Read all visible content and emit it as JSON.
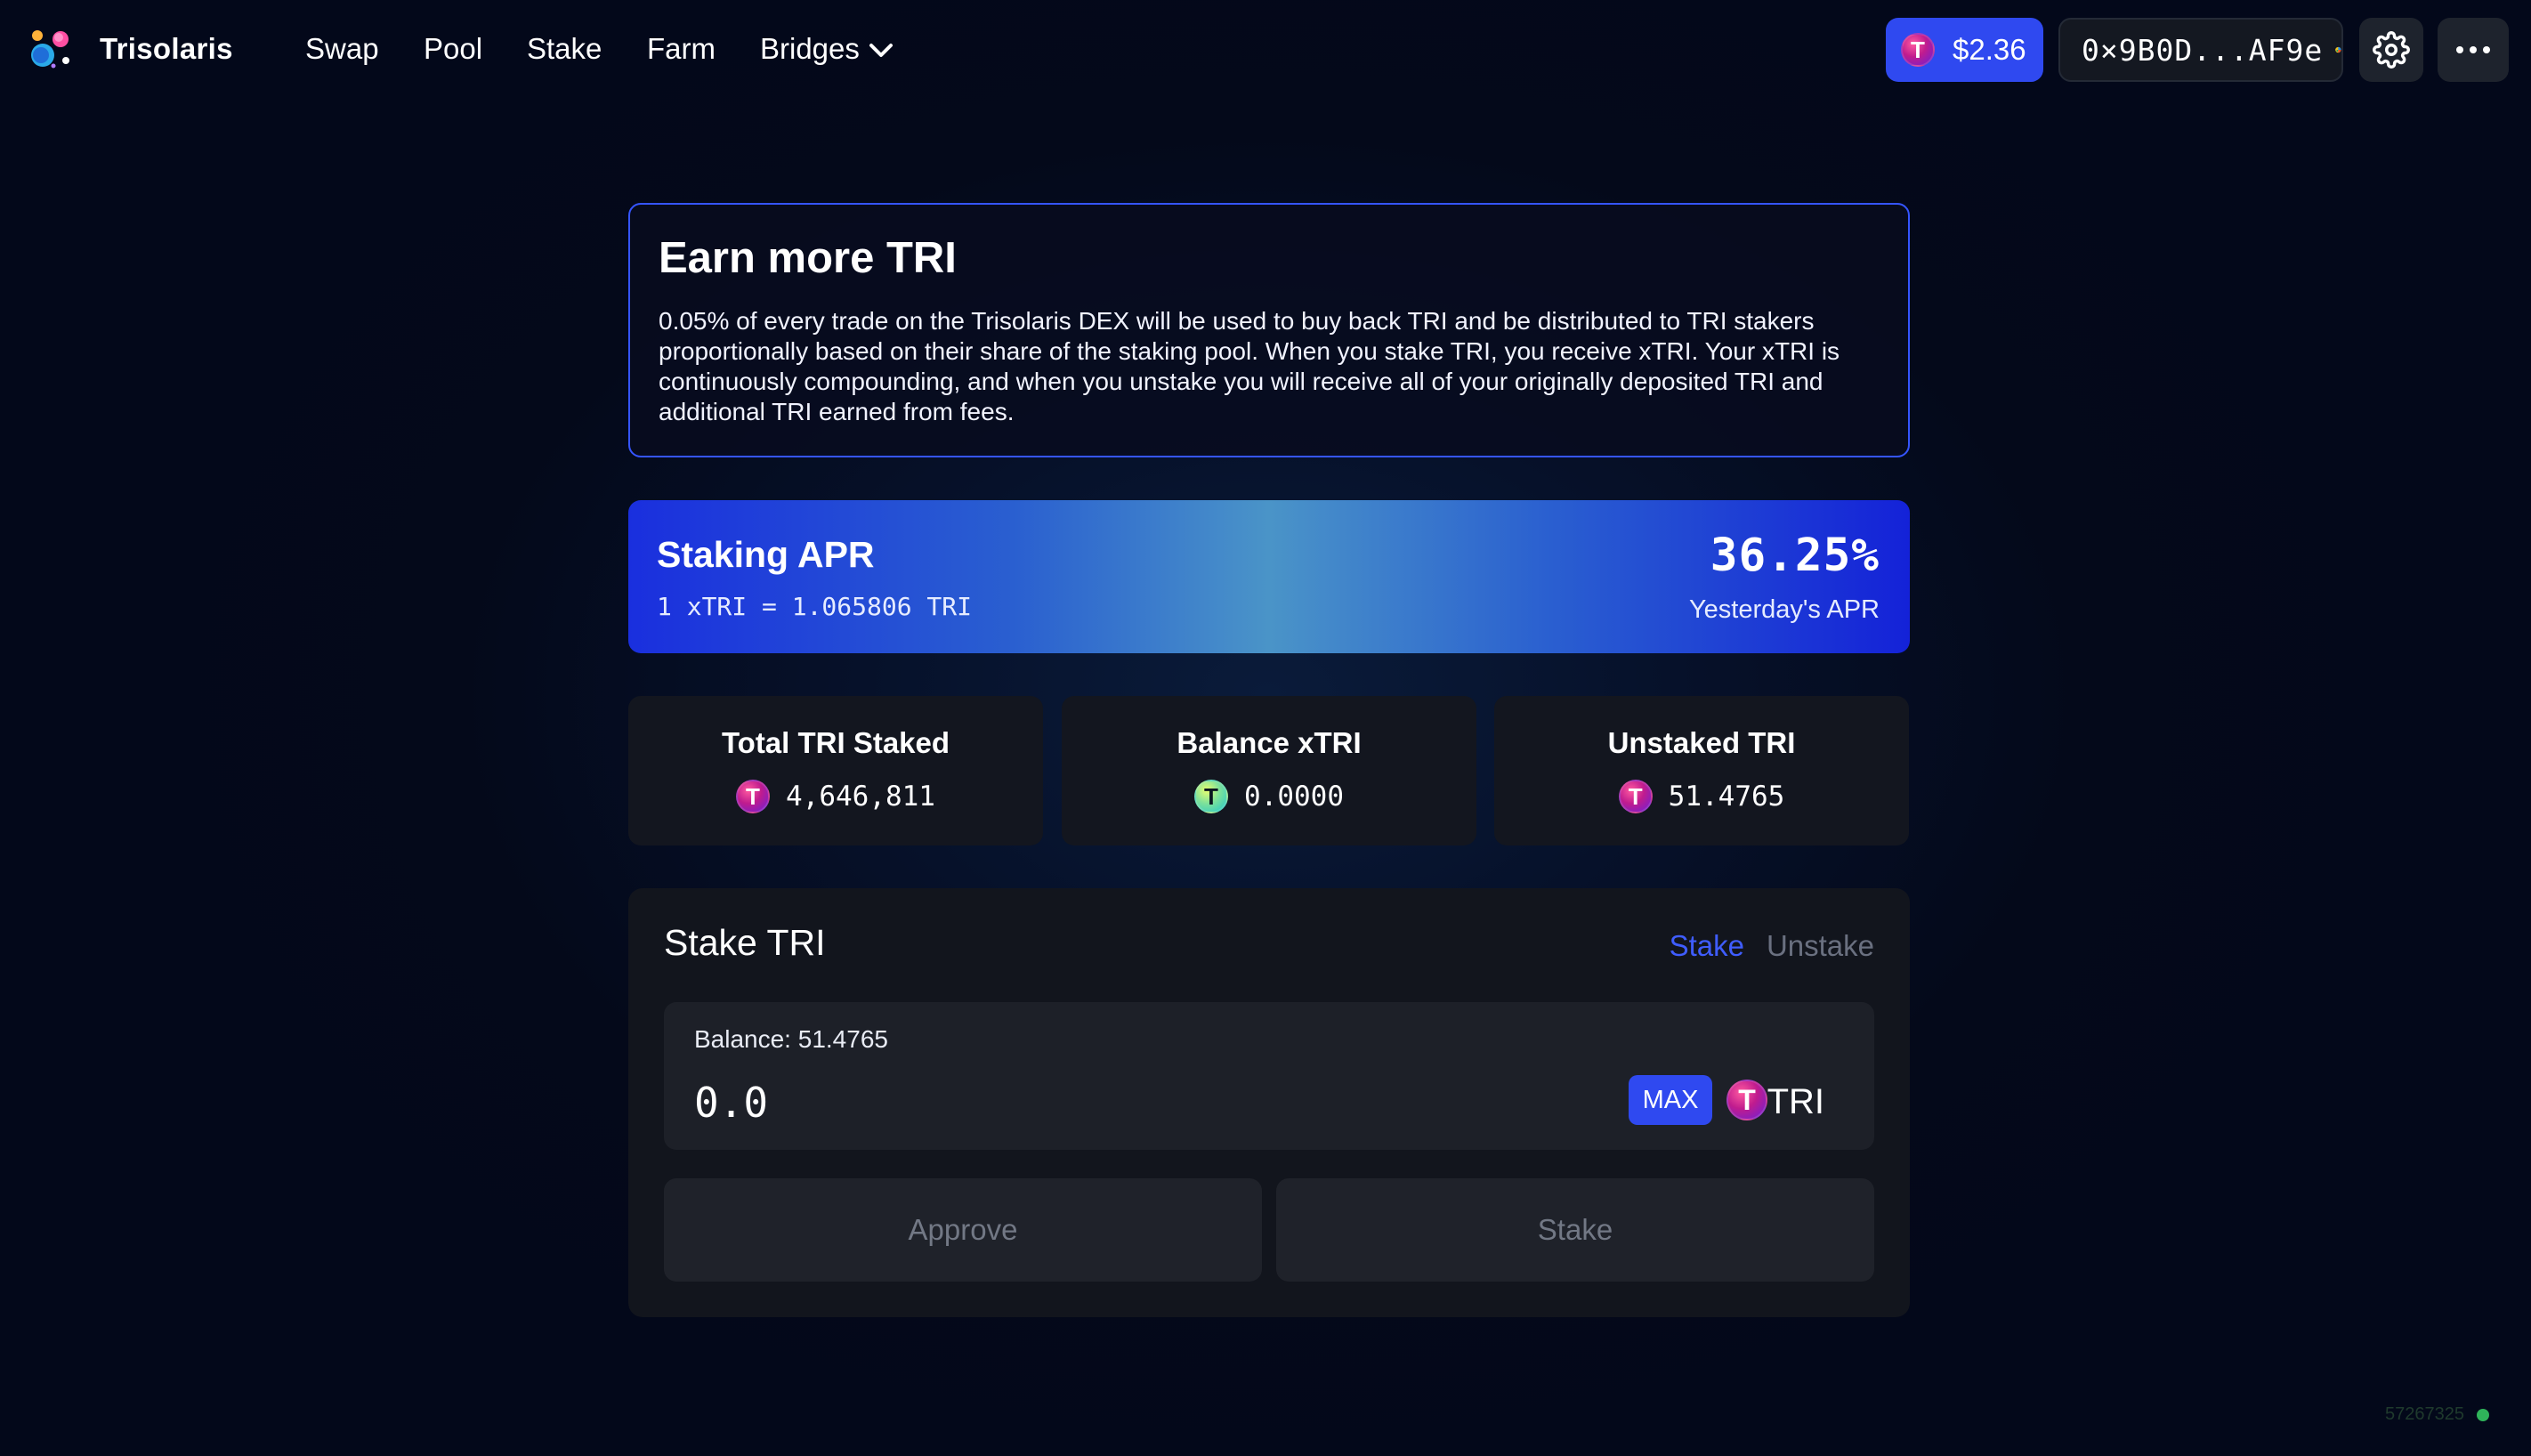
{
  "header": {
    "brand": "Trisolaris",
    "nav": {
      "swap": "Swap",
      "pool": "Pool",
      "stake": "Stake",
      "farm": "Farm",
      "bridges": "Bridges"
    },
    "price": "$2.36",
    "token_letter": "T",
    "wallet_address": "0×9B0D...AF9e"
  },
  "info": {
    "title": "Earn more TRI",
    "body": "0.05% of every trade on the Trisolaris DEX will be used to buy back TRI and be distributed to TRI stakers proportionally based on their share of the staking pool. When you stake TRI, you receive xTRI. Your xTRI is continuously compounding, and when you unstake you will receive all of your originally deposited TRI and additional TRI earned from fees."
  },
  "apr": {
    "title": "Staking APR",
    "rate": "1 xTRI = 1.065806 TRI",
    "value": "36.25%",
    "subtitle": "Yesterday's APR"
  },
  "stats": [
    {
      "label": "Total TRI Staked",
      "value": "4,646,811"
    },
    {
      "label": "Balance xTRI",
      "value": "0.0000"
    },
    {
      "label": "Unstaked TRI",
      "value": "51.4765"
    }
  ],
  "stake_panel": {
    "title": "Stake TRI",
    "tab_stake": "Stake",
    "tab_unstake": "Unstake",
    "balance_label": "Balance: 51.4765",
    "amount_placeholder": "0.0",
    "max_label": "MAX",
    "token_symbol": "TRI",
    "approve_label": "Approve",
    "stake_label": "Stake"
  },
  "footer": {
    "block_number": "57267325"
  },
  "colors": {
    "accent": "#2f49f0",
    "card": "#13161f",
    "status": "#2fb35a"
  },
  "icons": [
    "trisolaris-logo",
    "chevron-down-icon",
    "tri-token-icon",
    "xtri-token-icon",
    "wallet-avatar-icon",
    "gear-icon",
    "more-icon",
    "status-dot-icon"
  ]
}
